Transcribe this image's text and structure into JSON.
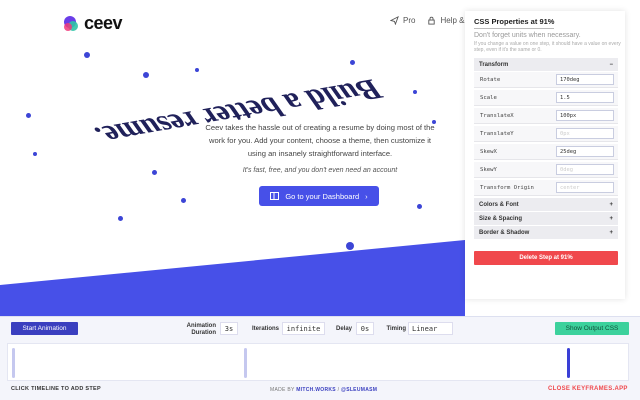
{
  "app": {
    "logo_text": "ceev",
    "nav": [
      {
        "label": "Pro",
        "icon": "paper-plane-icon"
      },
      {
        "label": "Help & I",
        "icon": "lock-icon"
      }
    ]
  },
  "hero": {
    "headline": "Build a better resume.",
    "description": "Ceev takes the hassle out of creating a resume by doing most of the work for you. Add your content, choose a theme, then customize it using an insanely straightforward interface.",
    "subline": "It's fast, free, and you don't even need an account",
    "cta_label": "Go to your Dashboard",
    "cta_icon": "layout-icon"
  },
  "panel": {
    "title": "CSS Properties at 91%",
    "note": "Don't forget units when necessary.",
    "note_small": "If you change a value on one step, it should have a value on every step, even if it's the same or 0.",
    "sections": [
      {
        "label": "Transform",
        "toggle": "−"
      },
      {
        "label": "Colors & Font",
        "toggle": "+"
      },
      {
        "label": "Size & Spacing",
        "toggle": "+"
      },
      {
        "label": "Border & Shadow",
        "toggle": "+"
      }
    ],
    "properties": [
      {
        "label": "Rotate",
        "value": "170deg",
        "placeholder": ""
      },
      {
        "label": "Scale",
        "value": "1.5",
        "placeholder": ""
      },
      {
        "label": "TranslateX",
        "value": "100px",
        "placeholder": ""
      },
      {
        "label": "TranslateY",
        "value": "",
        "placeholder": "0px"
      },
      {
        "label": "SkewX",
        "value": "25deg",
        "placeholder": ""
      },
      {
        "label": "SkewY",
        "value": "",
        "placeholder": "0deg"
      },
      {
        "label": "Transform Origin",
        "value": "",
        "placeholder": "center"
      }
    ],
    "delete_label": "Delete Step at 91%"
  },
  "editor": {
    "start_label": "Start Animation",
    "duration_label_1": "Animation",
    "duration_label_2": "Duration",
    "duration_value": "3s",
    "iterations_label": "Iterations",
    "iterations_value": "infinite",
    "delay_label": "Delay",
    "delay_value": "0s",
    "timing_label": "Timing",
    "timing_value": "Linear",
    "show_css_label": "Show Output CSS",
    "timeline_steps": [
      0,
      38,
      91
    ],
    "active_step": 91,
    "hint": "CLICK TIMELINE TO ADD STEP",
    "credit_prefix": "MADE BY",
    "credit_link1": "MITCH.WORKS",
    "credit_sep": "/",
    "credit_link2": "@SLEUMASM",
    "close_label": "CLOSE KEYFRAMES.APP"
  },
  "colors": {
    "brand_blue": "#4750e8",
    "editor_blue": "#3a3fbf",
    "delete_red": "#f0484c",
    "show_css_green": "#3cd19c",
    "headline": "#20215a"
  }
}
